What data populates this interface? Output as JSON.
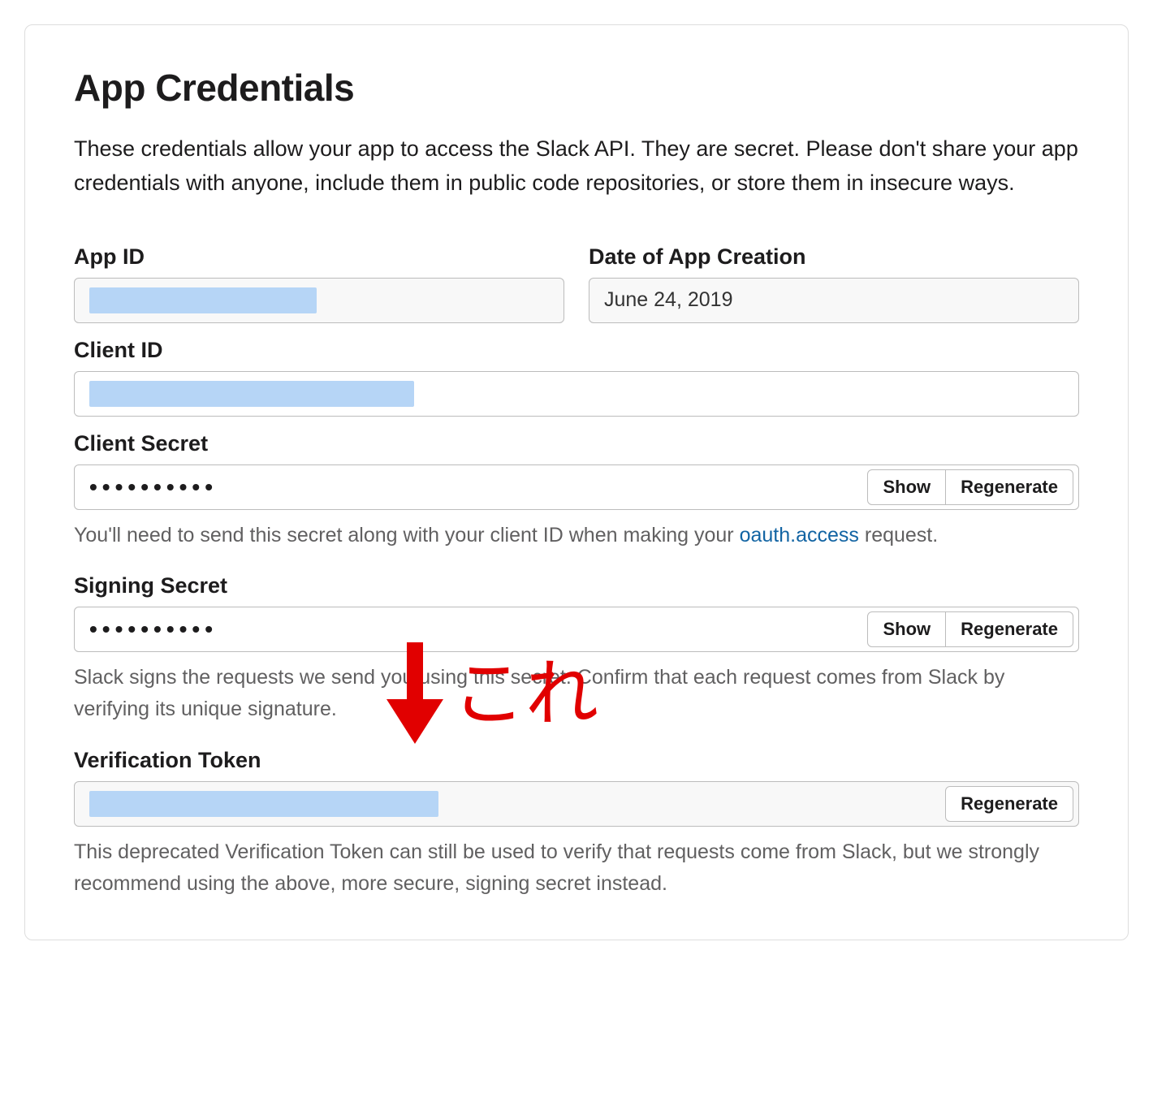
{
  "title": "App Credentials",
  "intro": "These credentials allow your app to access the Slack API. They are secret. Please don't share your app credentials with anyone, include them in public code repositories, or store them in insecure ways.",
  "fields": {
    "app_id": {
      "label": "App ID"
    },
    "date_created": {
      "label": "Date of App Creation",
      "value": "June 24, 2019"
    },
    "client_id": {
      "label": "Client ID"
    },
    "client_secret": {
      "label": "Client Secret",
      "masked": "••••••••••",
      "show_label": "Show",
      "regen_label": "Regenerate",
      "hint_pre": "You'll need to send this secret along with your client ID when making your ",
      "hint_link": "oauth.access",
      "hint_post": " request."
    },
    "signing_secret": {
      "label": "Signing Secret",
      "masked": "••••••••••",
      "show_label": "Show",
      "regen_label": "Regenerate",
      "hint": "Slack signs the requests we send you using this secret. Confirm that each request comes from Slack by verifying its unique signature."
    },
    "verification_token": {
      "label": "Verification Token",
      "regen_label": "Regenerate",
      "hint": "This deprecated Verification Token can still be used to verify that requests come from Slack, but we strongly recommend using the above, more secure, signing secret instead."
    }
  },
  "annotation_text": "これ"
}
